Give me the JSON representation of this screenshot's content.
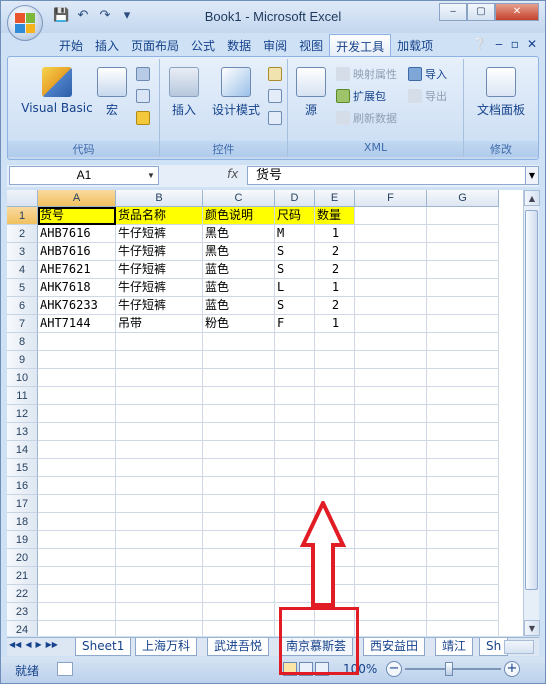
{
  "window": {
    "title": "Book1 - Microsoft Excel",
    "controls": [
      "‒",
      "▢",
      "✕"
    ]
  },
  "qat": {
    "icons": [
      "save-icon",
      "undo-icon",
      "redo-icon",
      "customize-icon"
    ]
  },
  "ribbon": {
    "tabs": [
      "开始",
      "插入",
      "页面布局",
      "公式",
      "数据",
      "审阅",
      "视图",
      "开发工具",
      "加载项"
    ],
    "active_tab": "开发工具",
    "groups": {
      "code": {
        "label": "代码",
        "visual_basic": "Visual Basic",
        "macro": "宏"
      },
      "controls": {
        "label": "控件",
        "insert": "插入",
        "design_mode": "设计模式"
      },
      "xml": {
        "label": "XML",
        "source": "源",
        "map_props": "映射属性",
        "expand_pack": "扩展包",
        "refresh": "刷新数据",
        "import": "导入",
        "export": "导出"
      },
      "modify": {
        "label": "修改",
        "doc_panel": "文档面板"
      }
    }
  },
  "formula_bar": {
    "name_box": "A1",
    "fx": "fx",
    "content": "货号"
  },
  "sheet": {
    "columns": [
      "A",
      "B",
      "C",
      "D",
      "E",
      "F",
      "G"
    ],
    "rows": [
      {
        "num": "1",
        "cells": [
          "货号",
          "货品名称",
          "颜色说明",
          "尺码",
          "数量"
        ]
      },
      {
        "num": "2",
        "cells": [
          "AHB7616",
          "牛仔短裤",
          "黑色",
          "M",
          "1"
        ]
      },
      {
        "num": "3",
        "cells": [
          "AHB7616",
          "牛仔短裤",
          "黑色",
          "S",
          "2"
        ]
      },
      {
        "num": "4",
        "cells": [
          "AHE7621",
          "牛仔短裤",
          "蓝色",
          "S",
          "2"
        ]
      },
      {
        "num": "5",
        "cells": [
          "AHK7618",
          "牛仔短裤",
          "蓝色",
          "L",
          "1"
        ]
      },
      {
        "num": "6",
        "cells": [
          "AHK76233",
          "牛仔短裤",
          "蓝色",
          "S",
          "2"
        ]
      },
      {
        "num": "7",
        "cells": [
          "AHT7144",
          "吊带",
          "粉色",
          "F",
          "1"
        ]
      },
      {
        "num": "8",
        "cells": []
      },
      {
        "num": "9",
        "cells": []
      },
      {
        "num": "10",
        "cells": []
      },
      {
        "num": "11",
        "cells": []
      },
      {
        "num": "12",
        "cells": []
      },
      {
        "num": "13",
        "cells": []
      },
      {
        "num": "14",
        "cells": []
      },
      {
        "num": "15",
        "cells": []
      },
      {
        "num": "16",
        "cells": []
      },
      {
        "num": "17",
        "cells": []
      },
      {
        "num": "18",
        "cells": []
      },
      {
        "num": "19",
        "cells": []
      },
      {
        "num": "20",
        "cells": []
      },
      {
        "num": "21",
        "cells": []
      },
      {
        "num": "22",
        "cells": []
      },
      {
        "num": "23",
        "cells": []
      },
      {
        "num": "24",
        "cells": []
      }
    ]
  },
  "sheet_tabs": [
    "Sheet1",
    "上海万科",
    "武进吾悦",
    "南京慕斯荟",
    "西安益田",
    "靖江",
    "Sh"
  ],
  "status": {
    "ready": "就绪",
    "zoom": "100%"
  },
  "colors": {
    "header_fill": "#ffff00",
    "annotation": "#e21c24"
  }
}
